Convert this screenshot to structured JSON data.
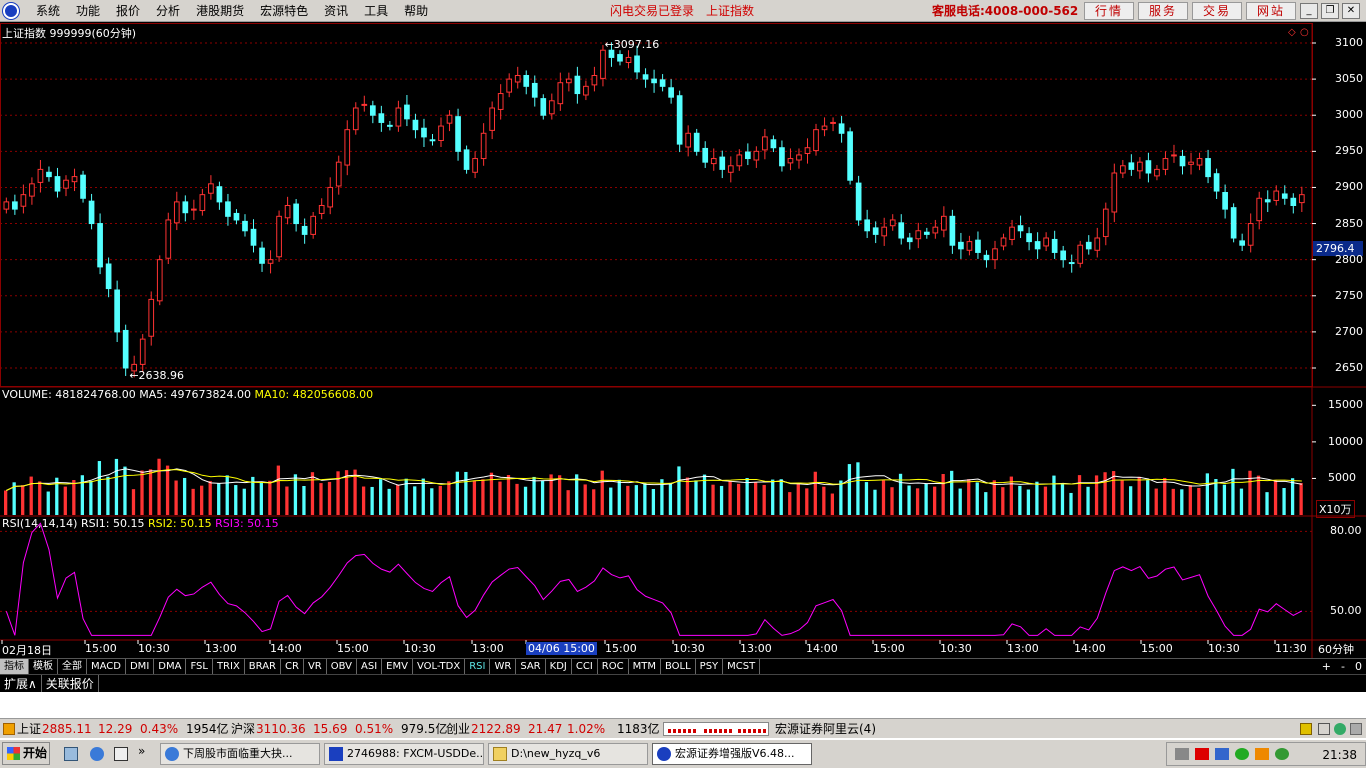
{
  "menubar": {
    "items": [
      "系统",
      "功能",
      "报价",
      "分析",
      "港股期货",
      "宏源特色",
      "资讯",
      "工具",
      "帮助"
    ],
    "flash_login": "闪电交易已登录",
    "index_name": "上证指数",
    "hotline": "客服电话:4008-000-562",
    "buttons": [
      "行情",
      "服务",
      "交易",
      "网站"
    ]
  },
  "chart": {
    "title": "上证指数 999999(60分钟)",
    "high_label": "3097.16",
    "low_label": "2638.96",
    "current_price": "2796.4",
    "price_ticks": [
      "3100",
      "3050",
      "3000",
      "2950",
      "2900",
      "2850",
      "2800",
      "2750",
      "2700",
      "2650"
    ],
    "volume_header": {
      "label": "VOLUME:",
      "value": "481824768.00",
      "ma5_label": "MA5:",
      "ma5": "497673824.00",
      "ma10_label": "MA10:",
      "ma10": "482056608.00"
    },
    "volume_ticks": [
      "15000",
      "10000",
      "5000"
    ],
    "volume_unit": "X10万",
    "rsi_header": {
      "label": "RSI(14,14,14)",
      "rsi1_label": "RSI1:",
      "rsi1": "50.15",
      "rsi2_label": "RSI2:",
      "rsi2": "50.15",
      "rsi3_label": "RSI3:",
      "rsi3": "50.15"
    },
    "rsi_ticks": [
      "80.00",
      "50.00"
    ],
    "time_axis": [
      "02月18日",
      "15:00",
      "10:30",
      "13:00",
      "14:00",
      "15:00",
      "10:30",
      "13:00",
      "04/06 15:00",
      "15:00",
      "10:30",
      "13:00",
      "14:00",
      "15:00",
      "10:30",
      "13:00",
      "14:00",
      "15:00",
      "10:30",
      "11:30"
    ],
    "period": "60分钟",
    "colors": {
      "up": "#ff3333",
      "down": "#54ffff",
      "ma5": "#ffffff",
      "ma10": "#ffff00",
      "rsi": "#ff00ff",
      "grid": "#8b0000"
    }
  },
  "chart_data": {
    "type": "candlestick",
    "period": "60分钟",
    "xlim": [
      "02月18日",
      "11:30"
    ],
    "ylim": [
      2620,
      3110
    ],
    "high": 3097.16,
    "low": 2638.96,
    "last": 2796.4,
    "close": [
      2880,
      2870,
      2890,
      2905,
      2925,
      2915,
      2895,
      2910,
      2915,
      2885,
      2850,
      2790,
      2760,
      2700,
      2650,
      2655,
      2690,
      2745,
      2800,
      2855,
      2880,
      2865,
      2870,
      2890,
      2905,
      2880,
      2860,
      2855,
      2840,
      2820,
      2795,
      2800,
      2860,
      2875,
      2850,
      2835,
      2860,
      2875,
      2900,
      2935,
      2980,
      3010,
      3015,
      3000,
      2990,
      2985,
      3010,
      2995,
      2980,
      2970,
      2965,
      2985,
      3000,
      2950,
      2925,
      2940,
      2975,
      3010,
      3030,
      3050,
      3055,
      3040,
      3025,
      3000,
      3020,
      3045,
      3050,
      3030,
      3040,
      3055,
      3090,
      3080,
      3075,
      3080,
      3060,
      3050,
      3045,
      3040,
      3025,
      2960,
      2975,
      2950,
      2935,
      2940,
      2925,
      2930,
      2945,
      2940,
      2950,
      2970,
      2955,
      2930,
      2940,
      2945,
      2955,
      2980,
      2985,
      2990,
      2975,
      2910,
      2855,
      2840,
      2835,
      2845,
      2855,
      2830,
      2825,
      2840,
      2835,
      2845,
      2860,
      2820,
      2815,
      2825,
      2810,
      2800,
      2815,
      2830,
      2845,
      2840,
      2825,
      2815,
      2830,
      2810,
      2800,
      2795,
      2820,
      2815,
      2830,
      2870,
      2920,
      2930,
      2925,
      2935,
      2920,
      2925,
      2940,
      2945,
      2930,
      2935,
      2940,
      2915,
      2895,
      2870,
      2830,
      2820,
      2850,
      2885,
      2880,
      2895,
      2885,
      2875,
      2890
    ],
    "volume_approx": {
      "unit": "X10万",
      "ylim": [
        0,
        15000
      ],
      "range": [
        2500,
        15000
      ]
    },
    "rsi": {
      "ylim": [
        40,
        85
      ],
      "last": 50.15
    }
  },
  "tabs": [
    "指标",
    "模板",
    "全部",
    "MACD",
    "DMI",
    "DMA",
    "FSL",
    "TRIX",
    "BRAR",
    "CR",
    "VR",
    "OBV",
    "ASI",
    "EMV",
    "VOL-TDX",
    "RSI",
    "WR",
    "SAR",
    "KDJ",
    "CCI",
    "ROC",
    "MTM",
    "BOLL",
    "PSY",
    "MCST"
  ],
  "tab_controls": [
    "+",
    "-",
    "0"
  ],
  "extbar": [
    "扩展∧",
    "关联报价"
  ],
  "status": {
    "sh_label": "上证",
    "sh_price": "2885.11",
    "sh_chg": "12.29",
    "sh_pct": "0.43%",
    "sh_amt": "1954亿",
    "hs_label": "沪深",
    "hs_price": "3110.36",
    "hs_chg": "15.69",
    "hs_pct": "0.51%",
    "hs_amt": "979.5亿",
    "cy_label": "创业",
    "cy_price": "2122.89",
    "cy_chg": "21.47",
    "cy_pct": "1.02%",
    "cy_amt": "1183亿",
    "broker": "宏源证券阿里云(4)"
  },
  "taskbar": {
    "start": "开始",
    "tasks": [
      "下周股市面临重大抉...",
      "2746988: FXCM-USDDe...",
      "D:\\new_hyzq_v6",
      "宏源证券增强版V6.48..."
    ],
    "clock": "21:38"
  }
}
